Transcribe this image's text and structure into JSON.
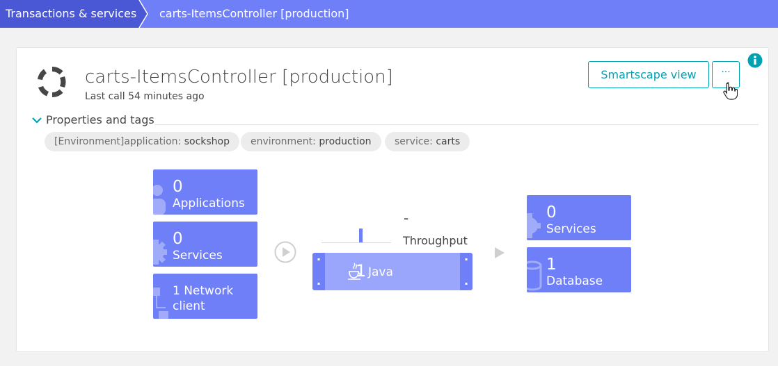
{
  "breadcrumb": {
    "items": [
      {
        "label": "Transactions & services"
      },
      {
        "label": "carts-ItemsController [production]"
      }
    ]
  },
  "service": {
    "title": "carts-ItemsController [production]",
    "last_call": "Last call 54 minutes ago"
  },
  "actions": {
    "smartscape_label": "Smartscape view",
    "more_label": "···"
  },
  "properties": {
    "toggle_label": "Properties and tags",
    "tags": [
      {
        "key": "[Environment]application:",
        "value": "sockshop"
      },
      {
        "key": "environment:",
        "value": "production"
      },
      {
        "key": "service:",
        "value": "carts"
      }
    ]
  },
  "callers": {
    "applications": {
      "count": "0",
      "label": "Applications"
    },
    "services": {
      "count": "0",
      "label": "Services"
    },
    "network": {
      "label": "1 Network client"
    }
  },
  "process": {
    "throughput_value": "-",
    "throughput_label": "Throughput",
    "count": "1",
    "tech": "Java"
  },
  "callees": {
    "services": {
      "count": "0",
      "label": "Services"
    },
    "database": {
      "count": "1",
      "label": "Database"
    }
  },
  "colors": {
    "topbar": "#6f7ff7",
    "breadcrumb_active": "#4b58d6",
    "accent": "#00a1b2",
    "tile": "#6f7ff7"
  }
}
